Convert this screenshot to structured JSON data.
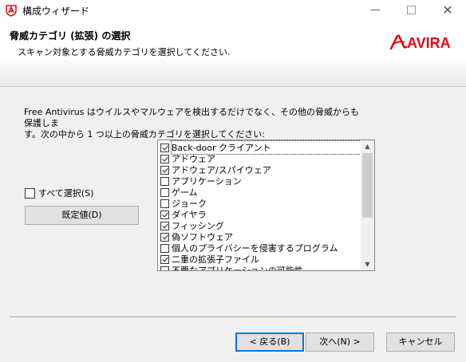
{
  "window": {
    "title": "構成ウィザード",
    "minimize_icon": "minimize-icon",
    "maximize_icon": "maximize-icon",
    "close_icon": "close-icon"
  },
  "header": {
    "title": "脅威カテゴリ (拡張) の選択",
    "subtitle": "スキャン対象とする脅威カテゴリを選択してください.",
    "logo_text": "AVIRA",
    "brand_color": "#e30613"
  },
  "description": {
    "line1": "Free Antivirus はウイルスやマルウェアを検出するだけでなく、その他の脅威からも保護しま",
    "line2": "す。次の中から 1 つ以上の脅威カテゴリを選択してください:"
  },
  "select_all": {
    "label": "すべて選択(S)",
    "checked": false
  },
  "defaults_button": {
    "label": "既定値(D)"
  },
  "categories": [
    {
      "label": "Back-door クライアント",
      "checked": true
    },
    {
      "label": "アドウェア",
      "checked": true
    },
    {
      "label": "アドウェア/スパイウェア",
      "checked": true
    },
    {
      "label": "アプリケーション",
      "checked": false
    },
    {
      "label": "ゲーム",
      "checked": false
    },
    {
      "label": "ジョーク",
      "checked": false
    },
    {
      "label": "ダイヤラ",
      "checked": true
    },
    {
      "label": "フィッシング",
      "checked": true
    },
    {
      "label": "偽ソフトウェア",
      "checked": true
    },
    {
      "label": "個人のプライバシーを侵害するプログラム",
      "checked": false
    },
    {
      "label": "二重の拡張子ファイル",
      "checked": true
    },
    {
      "label": "不要なアプリケーションの可能性",
      "checked": false
    }
  ],
  "footer": {
    "back_label": "< 戻る(B)",
    "next_label": "次へ(N) >",
    "cancel_label": "キャンセル"
  }
}
